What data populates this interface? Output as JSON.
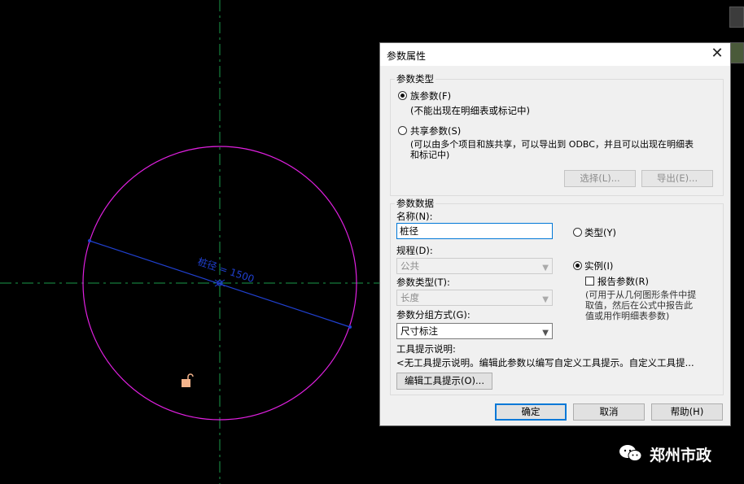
{
  "canvas": {
    "dimension_label": "桩径 = 1500",
    "colors": {
      "circle": "#e020e0",
      "dimension": "#2040d0",
      "axis": "#1a9a4a",
      "grip": "#f4b48c"
    }
  },
  "dialog": {
    "title": "参数属性",
    "close_icon": "close-icon",
    "param_type_group": {
      "label": "参数类型",
      "family_param": {
        "label": "族参数(F)",
        "desc": "(不能出现在明细表或标记中)",
        "selected": true
      },
      "shared_param": {
        "label": "共享参数(S)",
        "desc_line1": "(可以由多个项目和族共享，可以导出到 ODBC，并且可以出现在明细表",
        "desc_line2": "和标记中)",
        "selected": false
      },
      "select_button": "选择(L)...",
      "export_button": "导出(E)..."
    },
    "param_data_group": {
      "label": "参数数据",
      "name_label": "名称(N):",
      "name_value": "桩径",
      "discipline_label": "规程(D):",
      "discipline_value": "公共",
      "param_type_label": "参数类型(T):",
      "param_type_value": "长度",
      "group_label": "参数分组方式(G):",
      "group_value": "尺寸标注",
      "tooltip_label": "工具提示说明:",
      "tooltip_value": "<无工具提示说明。编辑此参数以编写自定义工具提示。自定义工具提...",
      "edit_tooltip_button": "编辑工具提示(O)...",
      "type_radio": {
        "label": "类型(Y)",
        "selected": false
      },
      "instance_radio": {
        "label": "实例(I)",
        "selected": true
      },
      "report_checkbox": {
        "label": "报告参数(R)",
        "checked": false
      },
      "report_desc_line1": "(可用于从几何图形条件中提",
      "report_desc_line2": "取值，然后在公式中报告此",
      "report_desc_line3": "值或用作明细表参数)"
    },
    "buttons": {
      "ok": "确定",
      "cancel": "取消",
      "help": "帮助(H)"
    }
  },
  "watermark": {
    "text": "郑州市政",
    "icon": "wechat-icon"
  }
}
